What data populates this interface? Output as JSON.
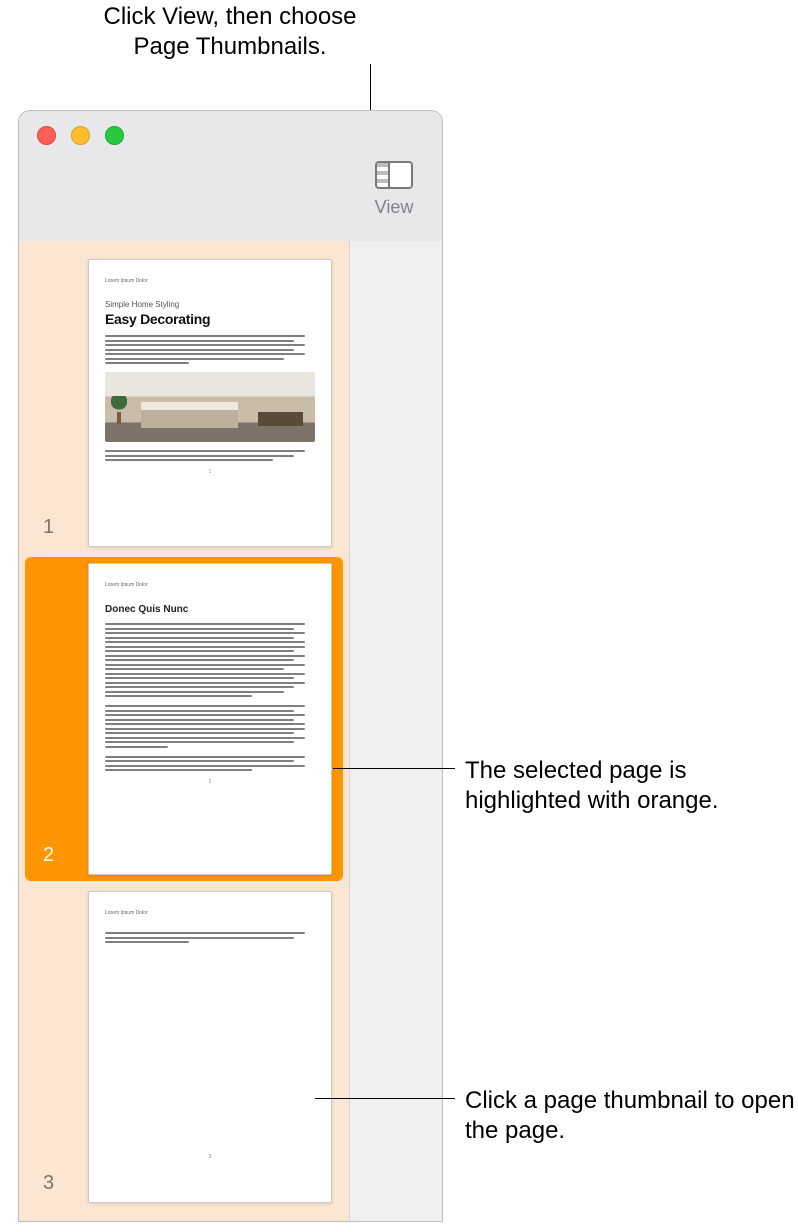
{
  "annotations": {
    "top": "Click View, then choose Page Thumbnails.",
    "selected": "The selected page is highlighted with orange.",
    "open": "Click a page thumbnail to open the page."
  },
  "toolbar": {
    "view_label": "View"
  },
  "sidebar": {
    "thumbnails": [
      {
        "number": "1",
        "header": "Lorem Ipsum Dolor",
        "subtitle": "Simple Home Styling",
        "headline": "Easy Decorating",
        "footer_page": "1",
        "selected": false
      },
      {
        "number": "2",
        "header": "Lorem Ipsum Dolor",
        "section_title": "Donec Quis Nunc",
        "footer_page": "2",
        "selected": true
      },
      {
        "number": "3",
        "header": "Lorem Ipsum Dolor",
        "footer_page": "3",
        "selected": false
      }
    ]
  },
  "colors": {
    "selection": "#ff9500",
    "sidebar_bg": "#fbe6d2"
  }
}
